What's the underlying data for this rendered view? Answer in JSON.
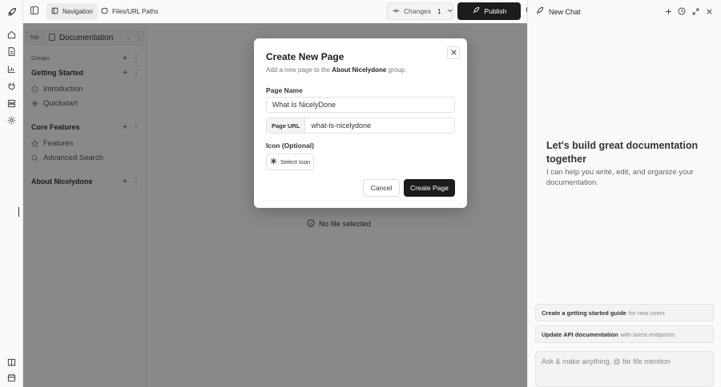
{
  "topbar": {
    "tabs": [
      {
        "label": "Navigation",
        "icon": "navigation-icon",
        "active": true
      },
      {
        "label": "Files/URL Paths",
        "icon": "files-icon",
        "active": false
      }
    ],
    "changes_label": "Changes",
    "changes_count": "1",
    "publish_label": "Publish"
  },
  "sidebar": {
    "tab_label": "Tab",
    "selector_value": "Documentation",
    "groups_label": "Groups",
    "sections": [
      {
        "title": "Getting Started",
        "items": [
          {
            "label": "Introduction",
            "icon": "circle-info-icon"
          },
          {
            "label": "Quickstart",
            "icon": "sparkle-icon"
          }
        ]
      },
      {
        "title": "Core Features",
        "items": [
          {
            "label": "Features",
            "icon": "star-icon"
          },
          {
            "label": "Advanced Search",
            "icon": "search-icon"
          }
        ]
      },
      {
        "title": "About Nicelydone",
        "items": []
      }
    ]
  },
  "main": {
    "no_file_text": "No file selected"
  },
  "modal": {
    "title": "Create New Page",
    "subtitle_pre": "Add a new page to the",
    "subtitle_group": "About Nicelydone",
    "subtitle_post": "group.",
    "page_name_label": "Page Name",
    "page_name_value": "What Is NicelyDone",
    "page_url_prefix": "Page URL",
    "page_url_value": "what-is-nicelydone",
    "icon_label": "Icon (Optional)",
    "select_icon_label": "Select Icon",
    "cancel_label": "Cancel",
    "create_label": "Create Page"
  },
  "chat": {
    "title": "New Chat",
    "hero_title": "Let's build great documentation together",
    "hero_sub": "I can help you write, edit, and organize your documentation.",
    "suggestions": [
      {
        "bold": "Create a getting started guide",
        "rest": "for new users"
      },
      {
        "bold": "Update API documentation",
        "rest": "with latest endpoints"
      }
    ],
    "input_placeholder": "Ask & make anything, @ for file mention"
  }
}
